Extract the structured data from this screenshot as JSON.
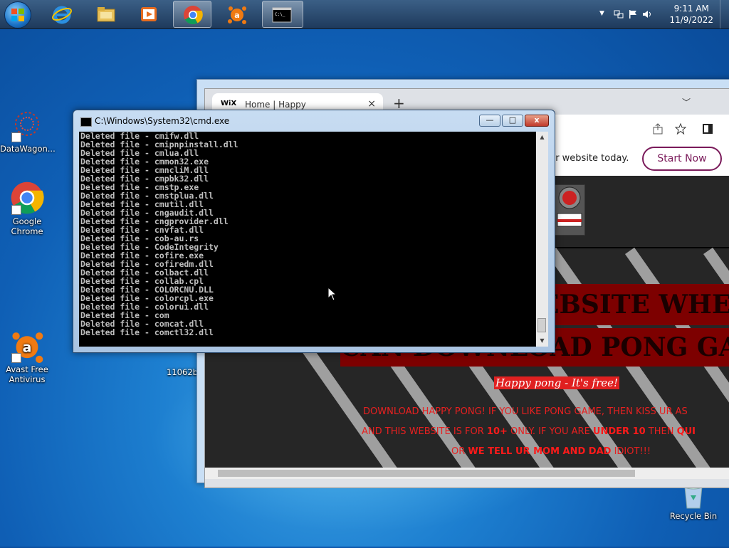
{
  "taskbar": {
    "clock_time": "9:11 AM",
    "clock_date": "11/9/2022",
    "pinned": [
      "internet-explorer-icon",
      "file-explorer-icon",
      "media-player-icon",
      "chrome-icon",
      "avast-icon",
      "cmd-icon"
    ]
  },
  "desktop": {
    "icons": [
      {
        "label": "DataWagon..."
      },
      {
        "label": "Google Chrome"
      },
      {
        "label": "Avast Free Antivirus"
      },
      {
        "label": "11062b"
      },
      {
        "label": "Recycle Bin"
      }
    ]
  },
  "browser": {
    "tab_logo": "WiX",
    "tab_title": "Home | Happy",
    "tab_close": "×",
    "new_tab": "+",
    "promo_text": "our website today.",
    "start_button": "Start Now",
    "banner_line1": "EBSITE WHER",
    "banner_line2": "CAN DOWNLOAD PONG GAM",
    "tagline": "Happy pong - It's free!",
    "line1": "DOWNLOAD HAPPY PONG! IF YOU LIKE PONG GAME, THEN KISS UR AS",
    "line2_a": "AND THIS WEBSITE IS FOR ",
    "line2_b": "10+",
    "line2_c": " ONLY. IF YOU ARE ",
    "line2_d": "UNDER 10",
    "line2_e": " THEN ",
    "line2_f": "QUI",
    "line3_a": "OR ",
    "line3_b": "WE TELL UR MOM AND DAD",
    "line3_c": " IDIOT!!!"
  },
  "cmd": {
    "title": "C:\\Windows\\System32\\cmd.exe",
    "minimize": "—",
    "maximize": "□",
    "close": "x",
    "lines": [
      "Deleted file - cmifw.dll",
      "Deleted file - cmipnpinstall.dll",
      "Deleted file - cmlua.dll",
      "Deleted file - cmmon32.exe",
      "Deleted file - cmncliM.dll",
      "Deleted file - cmpbk32.dll",
      "Deleted file - cmstp.exe",
      "Deleted file - cmstplua.dll",
      "Deleted file - cmutil.dll",
      "Deleted file - cngaudit.dll",
      "Deleted file - cngprovider.dll",
      "Deleted file - cnvfat.dll",
      "Deleted file - cob-au.rs",
      "Deleted file - CodeIntegrity",
      "Deleted file - cofire.exe",
      "Deleted file - cofiredm.dll",
      "Deleted file - colbact.dll",
      "Deleted file - collab.cpl",
      "Deleted file - COLORCNU.DLL",
      "Deleted file - colorcpl.exe",
      "Deleted file - colorui.dll",
      "Deleted file - com",
      "Deleted file - comcat.dll",
      "Deleted file - comctl32.dll"
    ]
  }
}
